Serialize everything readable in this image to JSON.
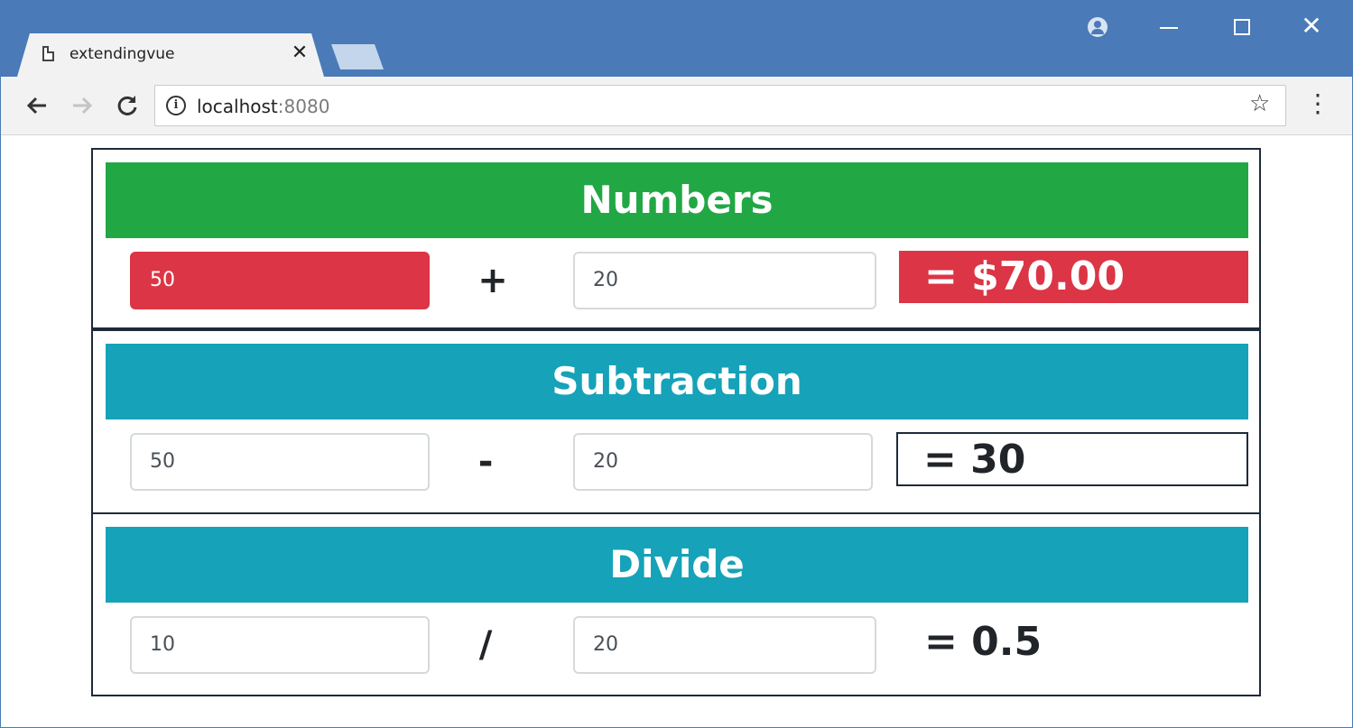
{
  "browser": {
    "tab_title": "extendingvue",
    "tab_close": "✕",
    "url_host": "localhost",
    "url_port": ":8080",
    "icons": {
      "back": "back-arrow-icon",
      "forward": "forward-arrow-icon",
      "reload": "reload-icon",
      "info": "info-icon",
      "bookmark": "star-icon",
      "menu": "kebab-menu-icon",
      "profile": "profile-icon"
    },
    "controls": {
      "close": "✕"
    }
  },
  "panels": {
    "numbers": {
      "title": "Numbers",
      "first": "50",
      "operator": "+",
      "second": "20",
      "result": "= $70.00"
    },
    "subtraction": {
      "title": "Subtraction",
      "first": "50",
      "operator": "-",
      "second": "20",
      "result": "= 30"
    },
    "divide": {
      "title": "Divide",
      "first": "10",
      "operator": "/",
      "second": "20",
      "result": "= 0.5"
    }
  },
  "colors": {
    "green_header": "#22a745",
    "teal_header": "#16a2b8",
    "danger": "#dc3545",
    "browser_frame": "#4a7ab8"
  }
}
